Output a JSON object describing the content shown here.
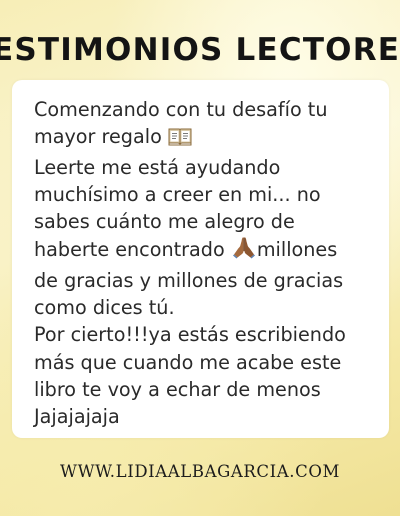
{
  "header": {
    "title": "ESTIMONIOS LECTORE"
  },
  "testimonial": {
    "lines": [
      "Comenzando con tu desafío tu",
      "mayor regalo",
      "Leerte me está ayudando",
      "muchísimo a creer en mi... no",
      "sabes cuánto me alegro de",
      "haberte encontrado",
      "millones",
      "de gracias  y millones de gracias",
      "como dices  tú.",
      "Por cierto!!!ya estás escribiendo",
      "más que cuando me acabe este",
      "libro te voy a echar de menos",
      "Jajajajaja"
    ],
    "icons": {
      "book": "open-book-icon",
      "hands": "praying-hands-icon"
    }
  },
  "footer": {
    "website": "WWW.LIDIAALBAGARCIA.COM"
  },
  "colors": {
    "background": "#f7eeb7",
    "card": "#ffffff",
    "text": "#2a2a2a",
    "title": "#141414"
  }
}
